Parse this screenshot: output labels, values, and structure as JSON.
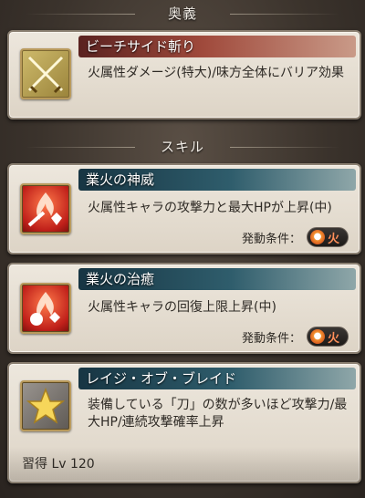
{
  "ougi": {
    "section_label": "奥義",
    "name": "ビーチサイド斬り",
    "description": "火属性ダメージ(特大)/味方全体にバリア効果"
  },
  "skills": {
    "section_label": "スキル",
    "items": [
      {
        "name": "業火の神威",
        "description": "火属性キャラの攻撃力と最大HPが上昇(中)",
        "condition_label": "発動条件：",
        "element": "火"
      },
      {
        "name": "業火の治癒",
        "description": "火属性キャラの回復上限上昇(中)",
        "condition_label": "発動条件：",
        "element": "火"
      },
      {
        "name": "レイジ・オブ・ブレイド",
        "description": "装備している「刀」の数が多いほど攻撃力/最大HP/連続攻撃確率上昇",
        "learn_label": "習得 Lv 120"
      }
    ]
  },
  "colors": {
    "ougi_title": "#a04a3c",
    "skill_title": "#2f5d6c",
    "fire": "#f08a2c"
  }
}
